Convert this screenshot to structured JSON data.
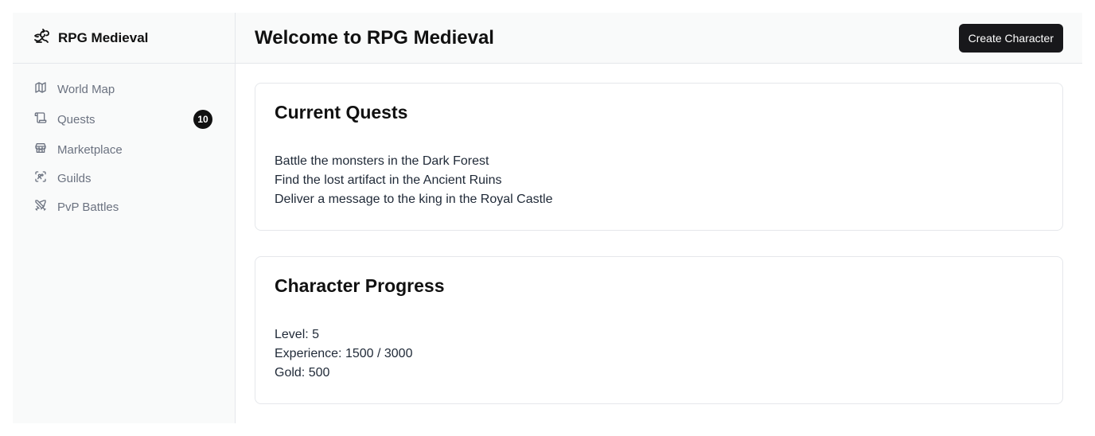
{
  "app": {
    "name": "RPG Medieval",
    "logo_icon": "dragon-icon"
  },
  "sidebar": {
    "items": [
      {
        "label": "World Map",
        "icon": "map-icon"
      },
      {
        "label": "Quests",
        "icon": "scroll-icon",
        "badge": "10"
      },
      {
        "label": "Marketplace",
        "icon": "store-icon"
      },
      {
        "label": "Guilds",
        "icon": "guild-icon"
      },
      {
        "label": "PvP Battles",
        "icon": "swords-icon"
      }
    ]
  },
  "header": {
    "title": "Welcome to RPG Medieval",
    "create_button_label": "Create Character"
  },
  "quests_card": {
    "title": "Current Quests",
    "items": [
      "Battle the monsters in the Dark Forest",
      "Find the lost artifact in the Ancient Ruins",
      "Deliver a message to the king in the Royal Castle"
    ]
  },
  "progress_card": {
    "title": "Character Progress",
    "level_text": "Level: 5",
    "experience_text": "Experience: 1500 / 3000",
    "gold_text": "Gold: 500"
  },
  "colors": {
    "sidebar_bg": "#f9fafa",
    "button_bg": "#18181b",
    "badge_bg": "#111111",
    "nav_text": "#6b7280",
    "border": "#e5e7eb"
  }
}
